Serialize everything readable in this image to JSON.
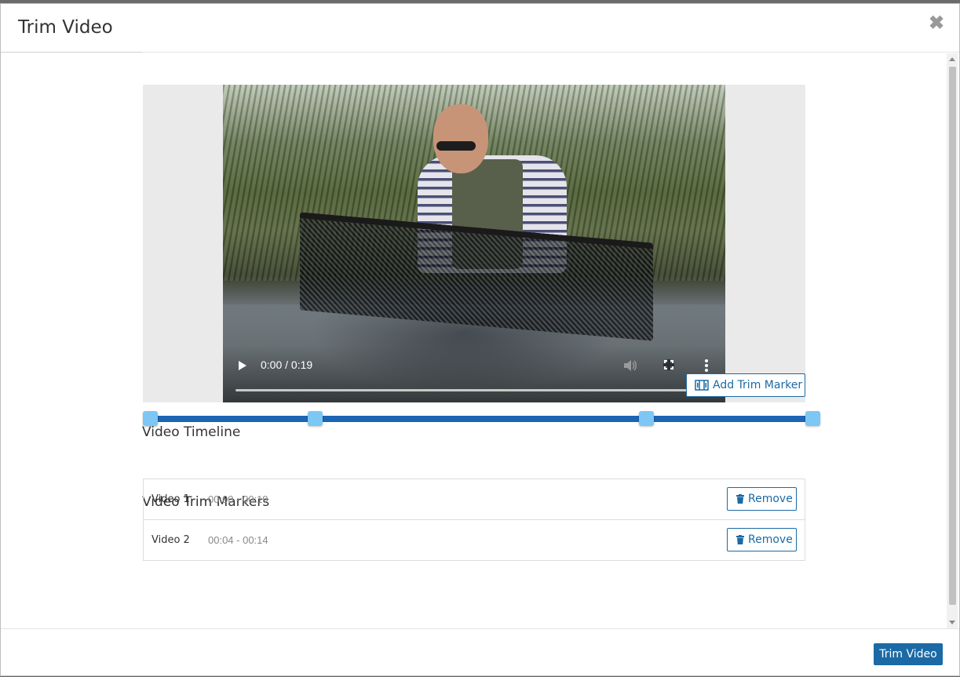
{
  "modal": {
    "title": "Trim Video",
    "close_glyph": "✖"
  },
  "video": {
    "time_display": "0:00 / 0:19",
    "controls": [
      "play-icon",
      "volume-icon",
      "fullscreen-icon",
      "more-vert-icon"
    ]
  },
  "timeline": {
    "title": "Video Timeline",
    "add_marker_label": "Add Trim Marker",
    "add_marker_icon": "trim-marker-icon",
    "handle_positions_pct": [
      0,
      25,
      75,
      100
    ],
    "colors": {
      "bar": "#1c64b4",
      "handle": "#7cc7f4"
    }
  },
  "markers": {
    "title": "Video Trim Markers",
    "items": [
      {
        "name": "Video 1",
        "range": "00:00 - 00:19",
        "remove_label": "Remove"
      },
      {
        "name": "Video 2",
        "range": "00:04 - 00:14",
        "remove_label": "Remove"
      }
    ],
    "remove_icon": "trash-icon"
  },
  "footer": {
    "submit_label": "Trim Video"
  },
  "colors": {
    "accent": "#1b6aa5"
  }
}
